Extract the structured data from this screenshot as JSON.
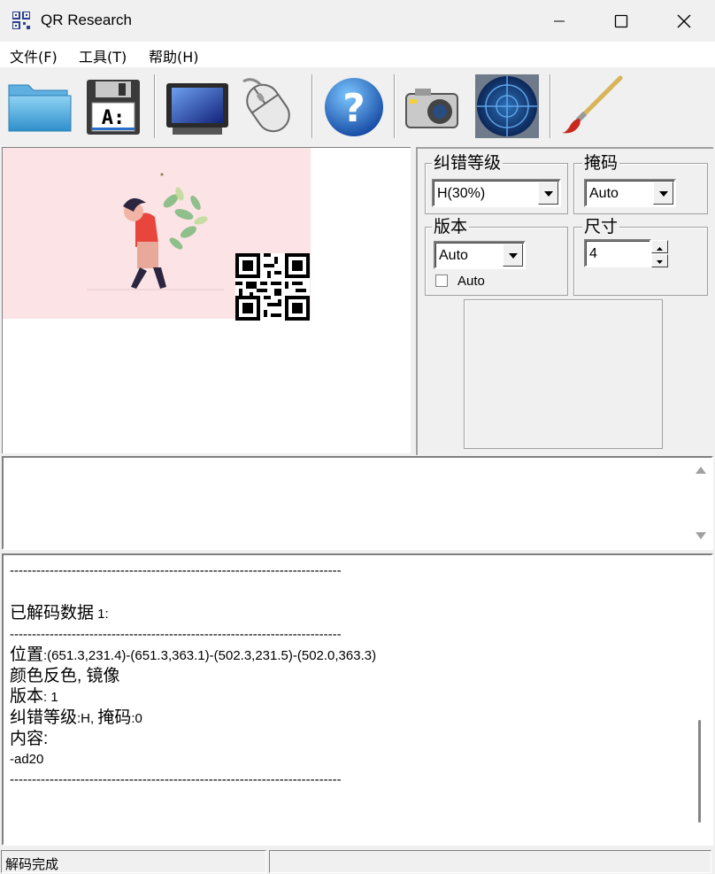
{
  "window": {
    "title": "QR Research"
  },
  "menu": [
    "文件(F)",
    "工具(T)",
    "帮助(H)"
  ],
  "toolbar": [
    "open-folder",
    "save-disk",
    "monitor",
    "mouse",
    "help",
    "camera",
    "radar",
    "paint-brush"
  ],
  "settings": {
    "ecc": {
      "label": "纠错等级",
      "value": "H(30%)"
    },
    "mask": {
      "label": "掩码",
      "value": "Auto"
    },
    "version": {
      "label": "版本",
      "value": "Auto",
      "checkbox_label": "Auto"
    },
    "size": {
      "label": "尺寸",
      "value": "4"
    }
  },
  "input": {
    "value": ""
  },
  "output": {
    "separator": "---------------------------------------------------------------------------",
    "decoded_label": "已解码数据",
    "decoded_count": " 1:",
    "pos_label": "位置",
    "pos_value": ":(651.3,231.4)-(651.3,363.1)-(502.3,231.5)-(502.0,363.3)",
    "flags": "颜色反色, 镜像",
    "version_label": "版本",
    "version_value": ": 1",
    "ecc_label": "纠错等级",
    "ecc_value": ":H, ",
    "mask_label": "掩码",
    "mask_value": ":0",
    "content_label": "内容:",
    "content_value": "-ad20"
  },
  "status": {
    "text": "解码完成"
  },
  "colors": {
    "illustration_bg": "#fce4e6",
    "accent": "#e8453c"
  }
}
